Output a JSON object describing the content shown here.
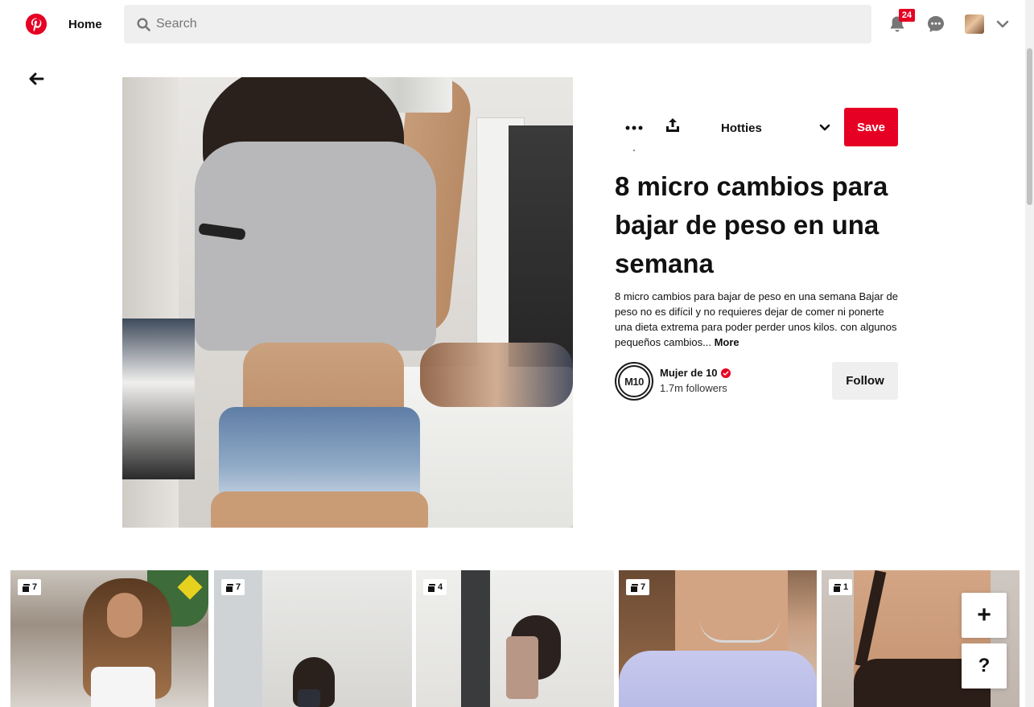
{
  "header": {
    "home_label": "Home",
    "search_placeholder": "Search",
    "notification_count": "24"
  },
  "pin": {
    "board_name": "Hotties",
    "save_label": "Save",
    "title": "8 micro cambios para bajar de peso en una semana",
    "description": "8 micro cambios para bajar de peso en una semana Bajar de peso no es difícil y no requieres dejar de comer ni ponerte una dieta extrema para poder perder unos kilos. con algunos pequeños cambios...",
    "more_label": "More"
  },
  "creator": {
    "avatar_text": "M10",
    "name": "Mujer de 10",
    "followers": "1.7m followers",
    "follow_label": "Follow"
  },
  "related": [
    {
      "count": "7"
    },
    {
      "count": "7"
    },
    {
      "count": "4"
    },
    {
      "count": "7"
    },
    {
      "count": "1"
    }
  ],
  "fab": {
    "add_label": "+",
    "help_label": "?"
  },
  "colors": {
    "brand": "#e60023",
    "button_gray": "#efefef"
  },
  "icons": [
    "pinterest-logo-icon",
    "search-icon",
    "bell-icon",
    "message-icon",
    "chevron-down-icon",
    "back-arrow-icon",
    "more-dots-icon",
    "share-icon",
    "visual-search-icon",
    "verified-icon",
    "board-count-icon"
  ]
}
